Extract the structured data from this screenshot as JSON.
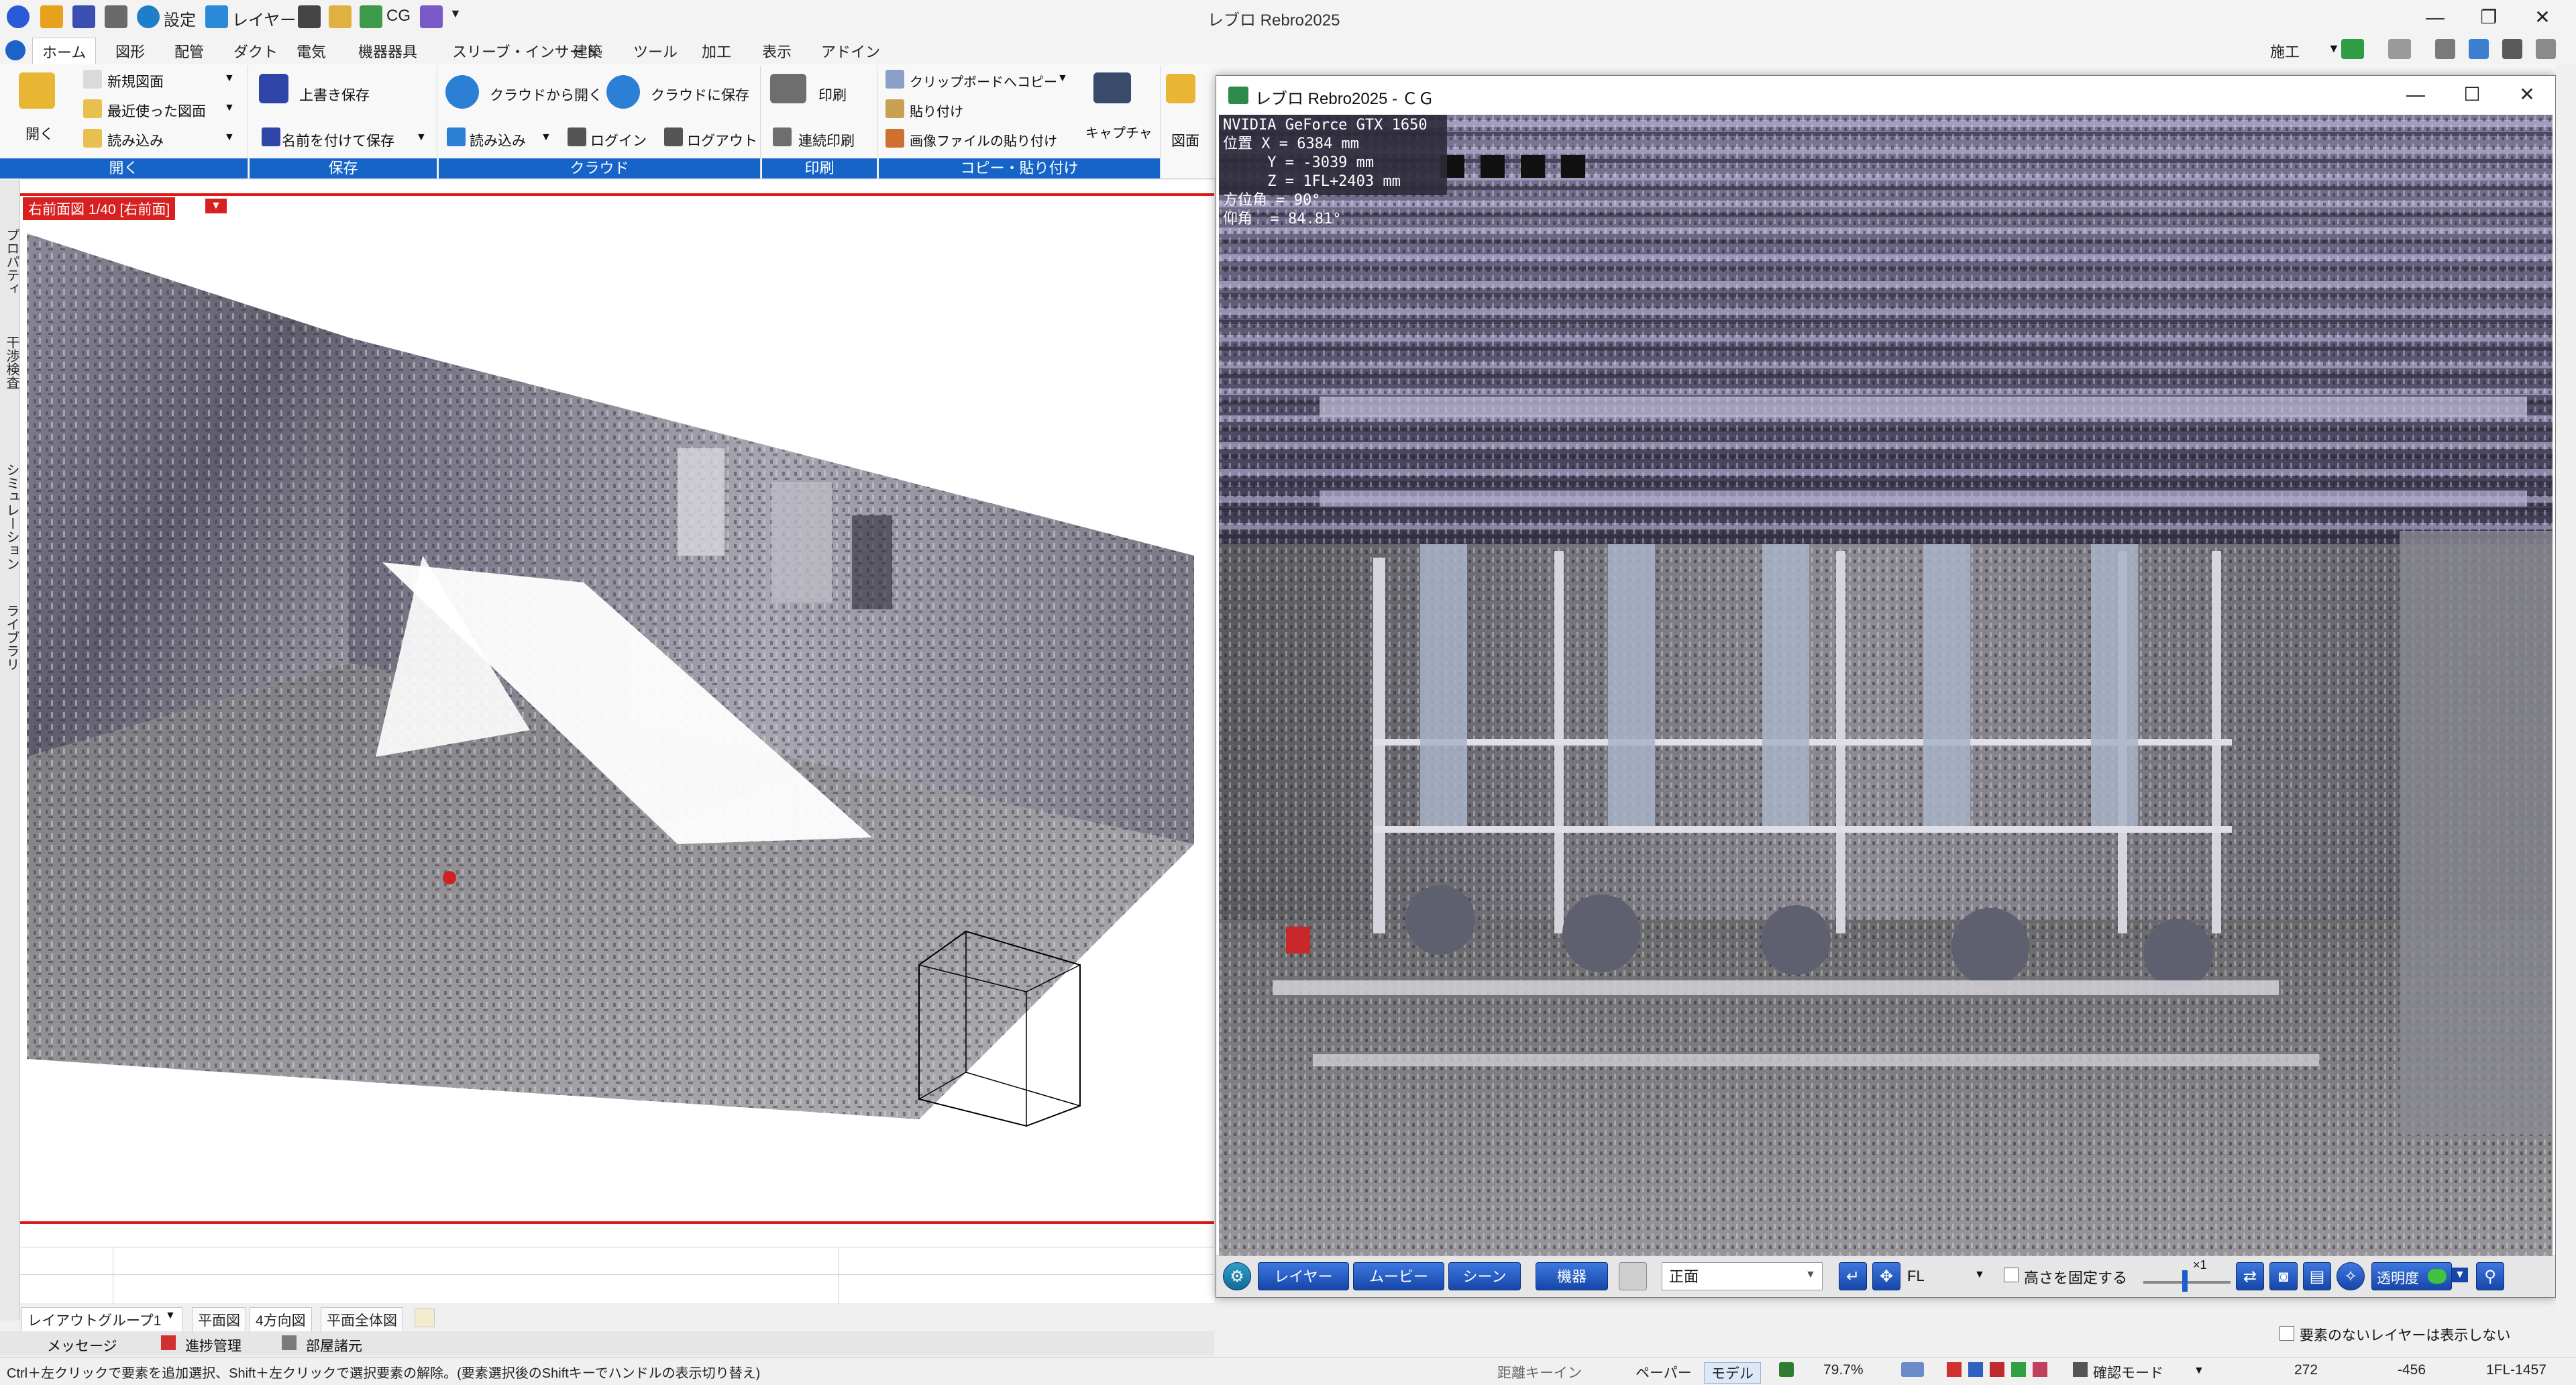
{
  "app": {
    "title": "レブロ Rebro2025"
  },
  "qat": {
    "settings": "設定",
    "layer": "レイヤー",
    "cg": "CG"
  },
  "window_controls": {
    "minimize": "—",
    "maximize": "❐",
    "close": "✕"
  },
  "menu": {
    "tabs": [
      "ホーム",
      "図形",
      "配管",
      "ダクト",
      "電気",
      "機器器具",
      "スリーブ・インサート",
      "建築",
      "ツール",
      "加工",
      "表示",
      "アドイン"
    ],
    "right": "施工"
  },
  "ribbon": {
    "open": {
      "label": "開く",
      "open": "開く",
      "new": "新規図面",
      "recent": "最近使った図面",
      "load": "読み込み"
    },
    "save": {
      "label": "保存",
      "overwrite": "上書き保存",
      "save_as": "名前を付けて保存"
    },
    "cloud": {
      "label": "クラウド",
      "open": "クラウドから開く",
      "save": "クラウドに保存",
      "load": "読み込み",
      "login": "ログイン",
      "logout": "ログアウト"
    },
    "print": {
      "label": "印刷",
      "print": "印刷",
      "batch": "連続印刷"
    },
    "copy": {
      "label": "コピー・貼り付け",
      "clipboard": "クリップボードへコピー",
      "paste": "貼り付け",
      "paste_image": "画像ファイルの貼り付け",
      "capture": "キャプチャ"
    },
    "extra": {
      "label": "図面"
    }
  },
  "left_rail": [
    "プロパティ",
    "干渉検査",
    "シミュレーション",
    "ライブラリ"
  ],
  "drawing": {
    "view_tag": "右前面図 1/40 [右前面]"
  },
  "cg": {
    "title": "レブロ Rebro2025 - ＣＧ",
    "overlay": [
      "NVIDIA GeForce GTX 1650",
      "位置 X = 6384 mm",
      "     Y = -3039 mm",
      "     Z = 1FL+2403 mm",
      "方位角 = 90°",
      "仰角  = 84.81°"
    ],
    "toolbar": {
      "layer": "レイヤー",
      "movie": "ムービー",
      "scene": "シーン",
      "equipment": "機器",
      "view_select": "正面",
      "floor": "FL",
      "fix_height": "高さを固定する",
      "zoom": "×1",
      "transparency": "透明度"
    }
  },
  "right_panel": {
    "hide_empty_layers": "要素のないレイヤーは表示しない"
  },
  "layout_tabs": {
    "group": "レイアウトグループ1",
    "tabs": [
      "平面図",
      "4方向図",
      "平面全体図"
    ]
  },
  "bottom_tabs": {
    "message": "メッセージ",
    "progress": "進捗管理",
    "history": "部屋諸元"
  },
  "status": {
    "hint": "Ctrl＋左クリックで要素を追加選択、Shift＋左クリックで選択要素の解除。(要素選択後のShiftキーでハンドルの表示切り替え)",
    "distance_key": "距離キーイン",
    "paper": "ペーパー",
    "model": "モデル",
    "zoom": "79.7%",
    "confirm_mode": "確認モード",
    "x": "272",
    "y": "-456",
    "floor": "1FL-1457"
  },
  "colors": {
    "accent": "#1664c8",
    "red_line": "#e01818",
    "tag_red": "#d82020"
  }
}
